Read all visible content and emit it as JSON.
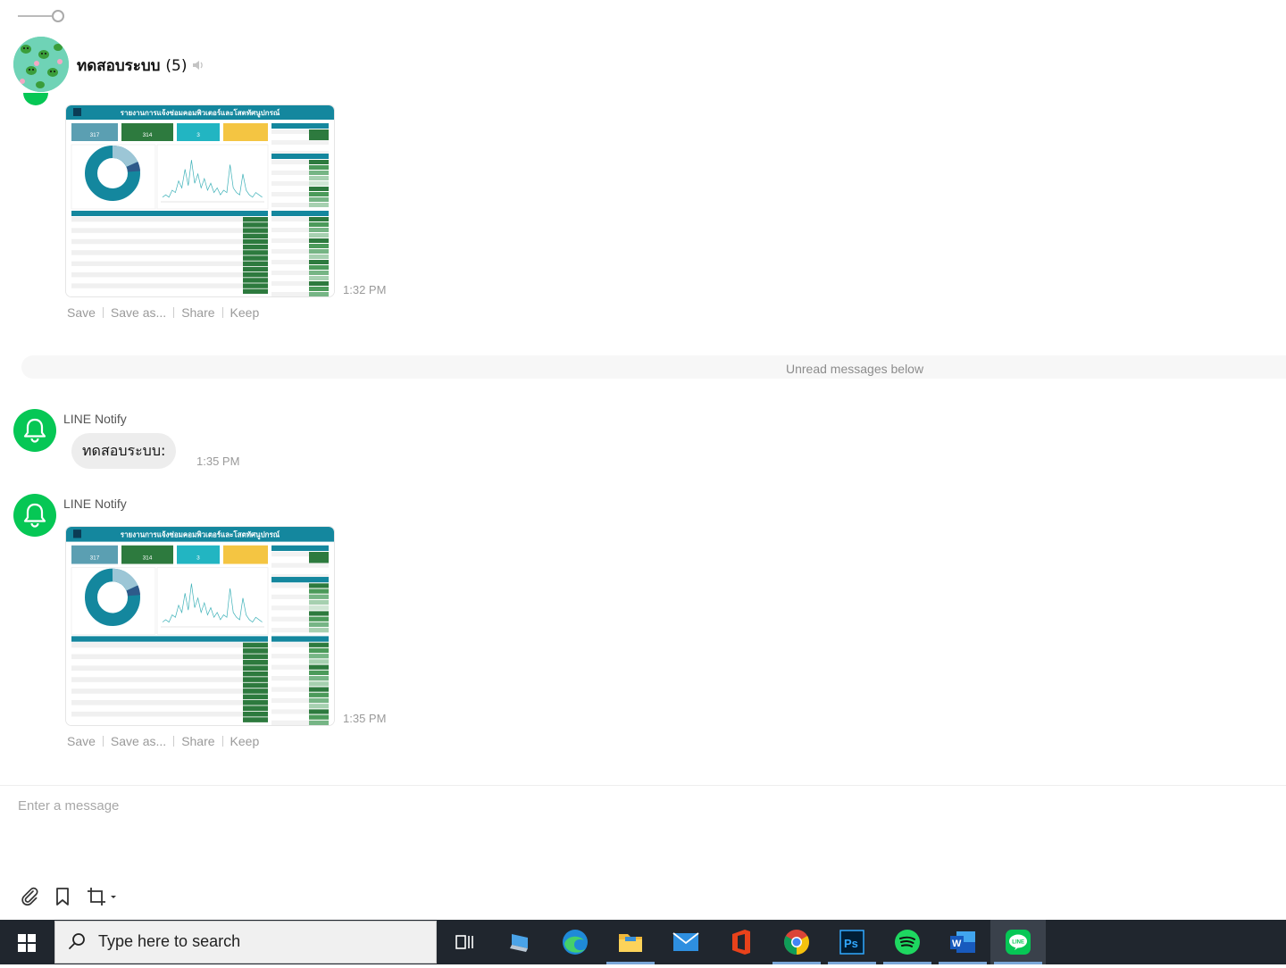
{
  "header": {
    "group_name": "ทดสอบระบบ",
    "member_count": "(5)"
  },
  "messages": [
    {
      "type": "image",
      "time": "1:32 PM",
      "report_title": "รายงานการแจ้งซ่อมคอมพิวเตอร์และโสตทัศนูปกรณ์",
      "kpis": [
        "317",
        "314",
        "3"
      ],
      "actions": [
        "Save",
        "Save as...",
        "Share",
        "Keep"
      ]
    },
    {
      "type": "text",
      "sender": "LINE Notify",
      "text": "ทดสอบระบบ:",
      "time": "1:35 PM"
    },
    {
      "type": "image",
      "sender": "LINE Notify",
      "time": "1:35 PM",
      "report_title": "รายงานการแจ้งซ่อมคอมพิวเตอร์และโสตทัศนูปกรณ์",
      "kpis": [
        "317",
        "314",
        "3"
      ],
      "actions": [
        "Save",
        "Save as...",
        "Share",
        "Keep"
      ]
    }
  ],
  "divider": {
    "text": "Unread messages below"
  },
  "composer": {
    "placeholder": "Enter a message"
  },
  "taskbar": {
    "search_placeholder": "Type here to search",
    "apps": [
      "task-view",
      "desktop",
      "edge",
      "file-explorer",
      "mail",
      "office",
      "chrome",
      "photoshop",
      "spotify",
      "word",
      "line"
    ]
  },
  "colors": {
    "line_green": "#06c755",
    "teal": "#14879e",
    "taskbar": "#20262e"
  }
}
